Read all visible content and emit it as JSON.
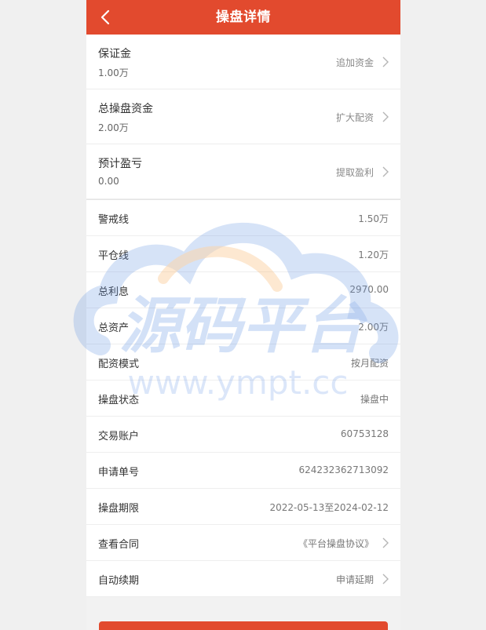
{
  "header": {
    "title": "操盘详情",
    "back_icon": "chevron-left-icon"
  },
  "top_rows": [
    {
      "label": "保证金",
      "value": "1.00万",
      "action": "追加资金"
    },
    {
      "label": "总操盘资金",
      "value": "2.00万",
      "action": "扩大配资"
    },
    {
      "label": "预计盈亏",
      "value": "0.00",
      "action": "提取盈利"
    }
  ],
  "rows": [
    {
      "label": "警戒线",
      "value": "1.50万"
    },
    {
      "label": "平仓线",
      "value": "1.20万"
    },
    {
      "label": "总利息",
      "value": "2970.00"
    },
    {
      "label": "总资产",
      "value": "2.00万"
    },
    {
      "label": "配资模式",
      "value": "按月配资"
    },
    {
      "label": "操盘状态",
      "value": "操盘中"
    },
    {
      "label": "交易账户",
      "value": "60753128"
    },
    {
      "label": "申请单号",
      "value": "624232362713092"
    },
    {
      "label": "操盘期限",
      "value": "2022-05-13至2024-02-12"
    },
    {
      "label": "查看合同",
      "value": "《平台操盘协议》"
    },
    {
      "label": "自动续期",
      "value": "申请延期"
    }
  ],
  "watermark": {
    "text": "源码平台",
    "url_text": "www.ympt.cc"
  },
  "colors": {
    "brand": "#e24a2e",
    "watermark_blue": "#5b8fe0",
    "watermark_orange": "#f7b267"
  }
}
